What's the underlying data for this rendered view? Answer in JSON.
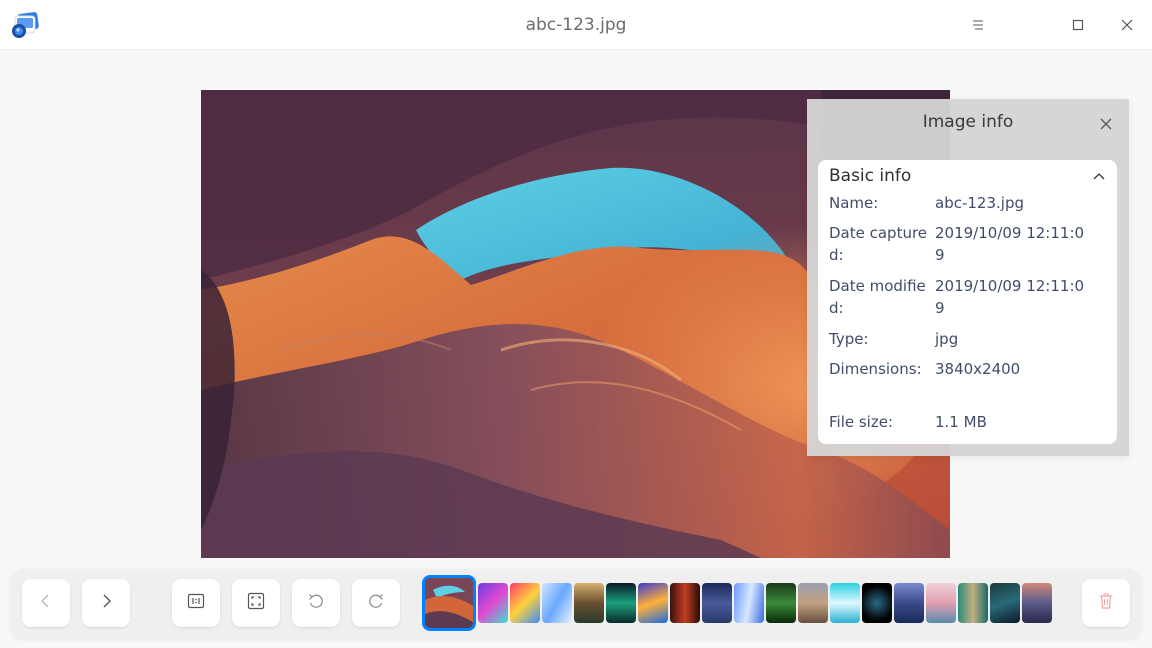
{
  "window": {
    "title": "abc-123.jpg",
    "app_icon": "image-viewer-icon",
    "controls": [
      "menu-icon",
      "maximize-icon",
      "close-icon"
    ]
  },
  "info_panel": {
    "title": "Image info",
    "section_title": "Basic info",
    "rows": [
      {
        "key": "Name:",
        "value": "abc-123.jpg"
      },
      {
        "key": "Date captured:",
        "value": "2019/10/09 12:11:09"
      },
      {
        "key": "Date modified:",
        "value": "2019/10/09 12:11:09"
      },
      {
        "key": "Type:",
        "value": "jpg"
      },
      {
        "key": "Dimensions:",
        "value": "3840x2400"
      },
      {
        "key": "File size:",
        "value": "1.1 MB"
      }
    ]
  },
  "toolbar": {
    "buttons": [
      "previous-icon",
      "next-icon",
      "original-size-icon",
      "fit-window-icon",
      "rotate-left-icon",
      "rotate-right-icon",
      "delete-icon"
    ],
    "thumbnail_count": 19,
    "active_thumbnail": 0
  },
  "colors": {
    "accent": "#0081ff",
    "panel_bg": "#d4d4d4",
    "delete": "#f36d6d"
  }
}
